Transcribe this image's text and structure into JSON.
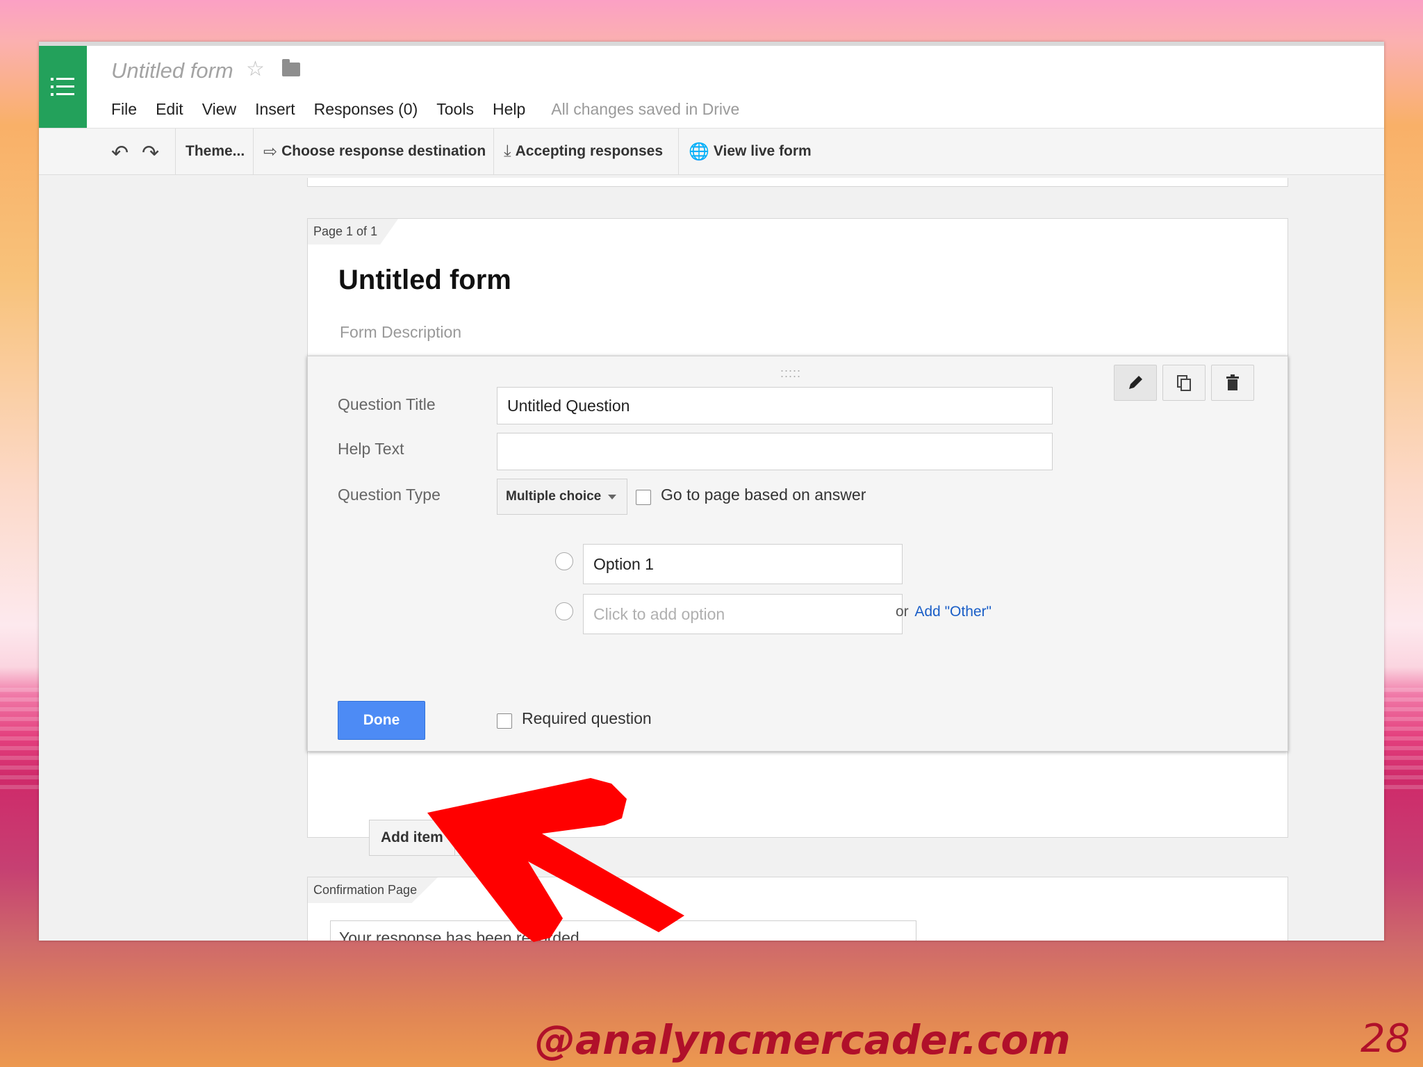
{
  "header": {
    "doc_title": "Untitled form",
    "menu": [
      "File",
      "Edit",
      "View",
      "Insert",
      "Responses (0)",
      "Tools",
      "Help"
    ],
    "save_status": "All changes saved in Drive"
  },
  "toolbar": {
    "theme": "Theme...",
    "response_destination": "Choose response destination",
    "accepting": "Accepting responses",
    "view_live": "View live form"
  },
  "form": {
    "page_label": "Page 1 of 1",
    "title": "Untitled form",
    "description_placeholder": "Form Description"
  },
  "question": {
    "title_label": "Question Title",
    "title_value": "Untitled Question",
    "help_label": "Help Text",
    "help_value": "",
    "type_label": "Question Type",
    "type_value": "Multiple choice",
    "go_to_page": "Go to page based on answer",
    "options": [
      "Option 1"
    ],
    "add_option_placeholder": "Click to add option",
    "or_text": "or",
    "add_other": "Add \"Other\"",
    "done": "Done",
    "required": "Required question"
  },
  "add_item": "Add item",
  "confirmation": {
    "label": "Confirmation Page",
    "message": "Your response has been recorded."
  },
  "slide": {
    "handle": "@analyncmercader.com",
    "number": "28"
  }
}
